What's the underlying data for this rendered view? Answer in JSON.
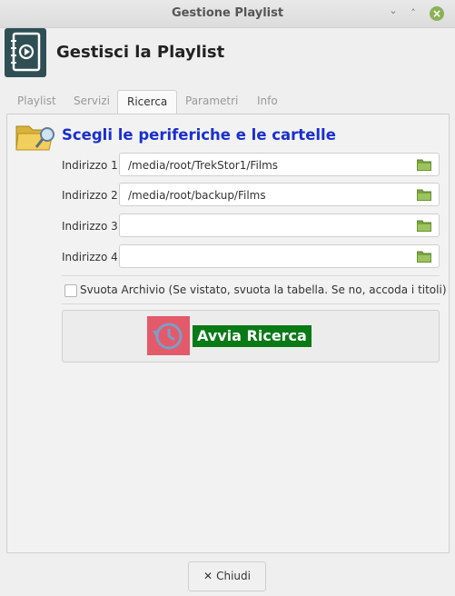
{
  "window": {
    "title": "Gestione Playlist",
    "minimize_glyph": "⌄",
    "maximize_glyph": "˄",
    "close_glyph": "×"
  },
  "header": {
    "title": "Gestisci la Playlist",
    "icon": "playlist-file-icon"
  },
  "tabs": [
    {
      "label": "Playlist",
      "active": false
    },
    {
      "label": "Servizi",
      "active": false
    },
    {
      "label": "Ricerca",
      "active": true
    },
    {
      "label": "Parametri",
      "active": false
    },
    {
      "label": "Info",
      "active": false
    }
  ],
  "section": {
    "title": "Scegli le periferiche e le cartelle",
    "icon": "folder-search-icon"
  },
  "addresses": [
    {
      "label": "Indirizzo 1",
      "value": "/media/root/TrekStor1/Films"
    },
    {
      "label": "Indirizzo 2",
      "value": "/media/root/backup/Films"
    },
    {
      "label": "Indirizzo 3",
      "value": ""
    },
    {
      "label": "Indirizzo 4",
      "value": ""
    }
  ],
  "clear_archive": {
    "label": "Svuota Archivio (Se vistato, svuota la tabella. Se no, accoda i titoli)",
    "checked": false
  },
  "search_button": {
    "label": "Avvia Ricerca",
    "icon": "history-clock-icon"
  },
  "close_button": {
    "label": "Chiudi",
    "icon": "close-icon"
  },
  "colors": {
    "section_title": "#1a2fcf",
    "search_label_bg": "#087a16",
    "search_icon_bg": "#e35a6a",
    "folder_green": "#7aa33f",
    "window_close": "#8bb158"
  }
}
